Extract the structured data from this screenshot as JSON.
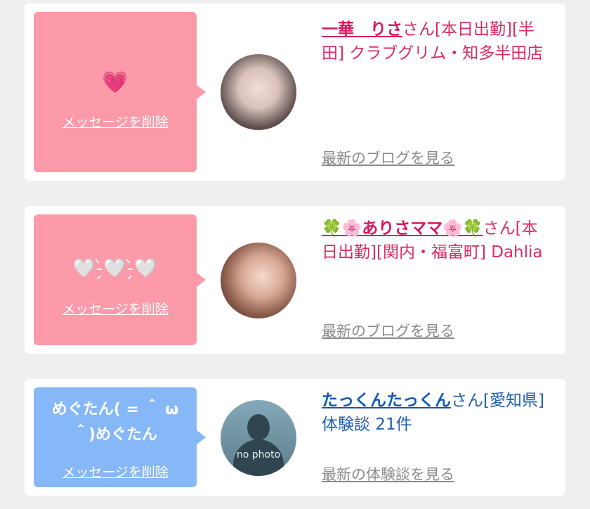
{
  "colors": {
    "background": "#efefef",
    "pink_bubble": "#fc9aa9",
    "blue_bubble": "#86b7f6",
    "pink_text": "#dc2b63",
    "blue_text": "#1d5fb0",
    "link_gray": "#8a8a8a"
  },
  "cards": [
    {
      "message": "💗",
      "delete_label": "メッセージを削除",
      "avatar": "girl-photo",
      "name": "一華　りさ",
      "info": "さん[本日出勤][半田] クラブグリム・知多半田店",
      "link_label": "最新のブログを見る"
    },
    {
      "message": "🤍-̗̀🤍-̗̀🤍",
      "delete_label": "メッセージを削除",
      "avatar": "girl-photo",
      "name": "🍀🌸ありさママ🌸🍀",
      "info": "さん[本日出勤][関内・福富町] Dahlia",
      "link_label": "最新のブログを見る"
    },
    {
      "message": "めぐたん( = ＾ ω ＾)めぐたん",
      "delete_label": "メッセージを削除",
      "avatar": "no-photo",
      "avatar_text": "no photo",
      "name": "たっくんたっくん",
      "info": "さん[愛知県]体験談 21件",
      "link_label": "最新の体験談を見る"
    }
  ]
}
